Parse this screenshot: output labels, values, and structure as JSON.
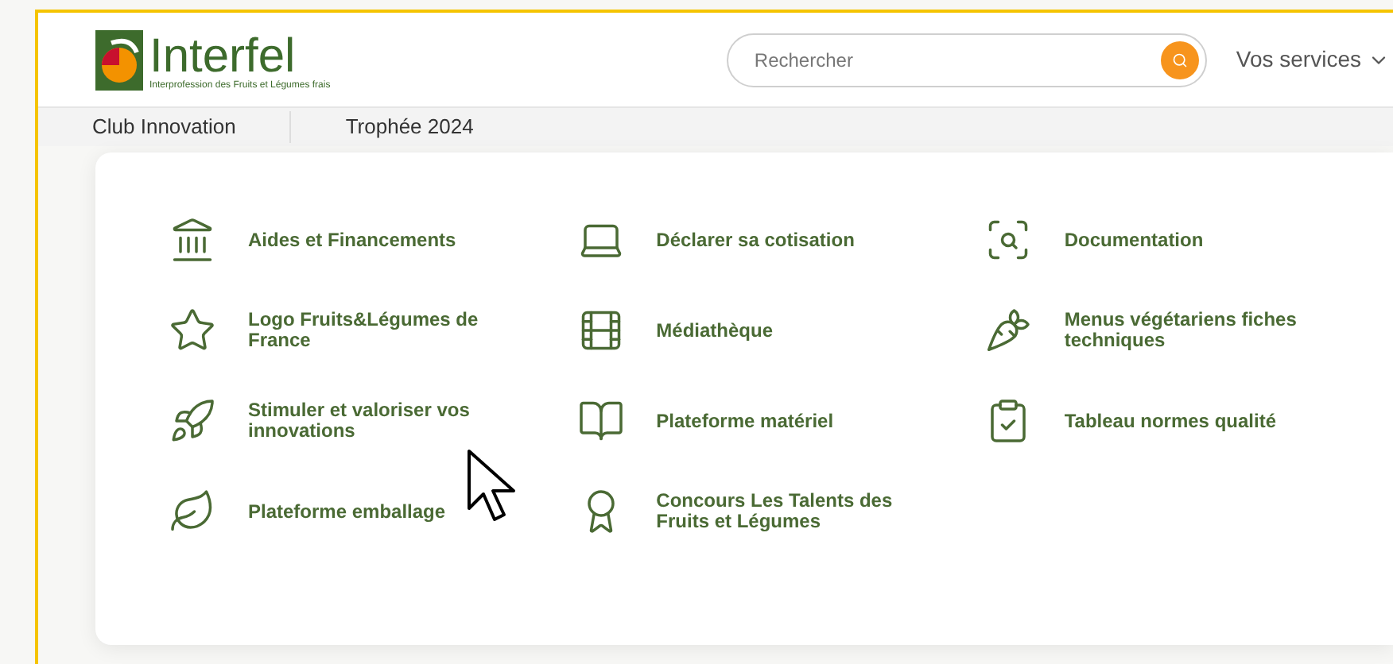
{
  "header": {
    "logo": {
      "name": "Interfel",
      "tagline": "Interprofession des Fruits et Légumes frais"
    },
    "search": {
      "placeholder": "Rechercher"
    },
    "menu": {
      "label": "Vos services"
    }
  },
  "nav": [
    {
      "label": "Club Innovation"
    },
    {
      "label": "Trophée 2024"
    }
  ],
  "services_menu": {
    "columns": [
      [
        {
          "label": "Aides et Financements"
        },
        {
          "label": "Logo Fruits&Légumes de France"
        },
        {
          "label": "Stimuler et valoriser vos innovations"
        },
        {
          "label": "Plateforme emballage"
        }
      ],
      [
        {
          "label": "Déclarer sa cotisation"
        },
        {
          "label": "Médiathèque"
        },
        {
          "label": "Plateforme matériel"
        },
        {
          "label": "Concours Les Talents des Fruits et Légumes"
        }
      ],
      [
        {
          "label": "Documentation"
        },
        {
          "label": "Menus végétariens fiches techniques"
        },
        {
          "label": "Tableau normes qualité"
        }
      ]
    ]
  }
}
